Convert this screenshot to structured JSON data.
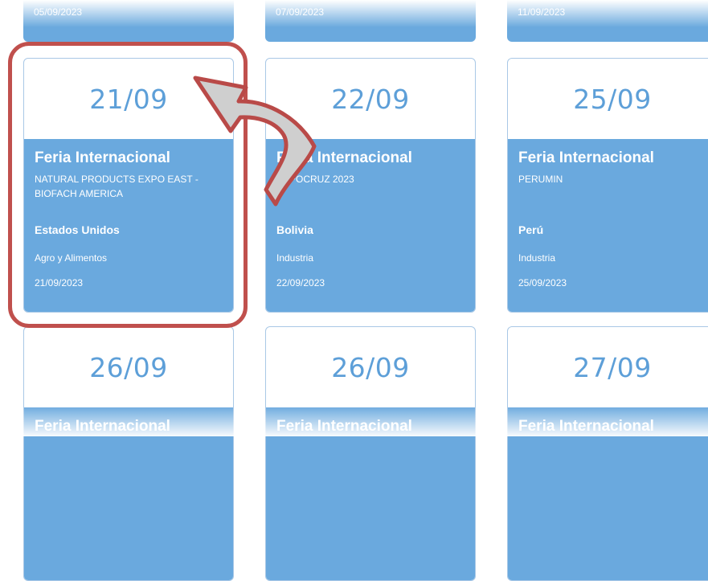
{
  "top_row": [
    {
      "date": "05/09/2023"
    },
    {
      "date": "07/09/2023"
    },
    {
      "date": "11/09/2023"
    }
  ],
  "events": [
    {
      "short_date": "21/09",
      "type": "Feria Internacional",
      "name": "NATURAL PRODUCTS EXPO EAST - BIOFACH AMERICA",
      "country": "Estados Unidos",
      "sector": "Agro y Alimentos",
      "date": "21/09/2023"
    },
    {
      "short_date": "22/09",
      "type": "Feria Internacional",
      "name": "EXPOCRUZ 2023",
      "country": "Bolivia",
      "sector": "Industria",
      "date": "22/09/2023"
    },
    {
      "short_date": "25/09",
      "type": "Feria Internacional",
      "name": "PERUMIN",
      "country": "Perú",
      "sector": "Industria",
      "date": "25/09/2023"
    },
    {
      "short_date": "26/09",
      "type": "Feria Internacional"
    },
    {
      "short_date": "26/09",
      "type": "Feria Internacional"
    },
    {
      "short_date": "27/09",
      "type": "Feria Internacional"
    }
  ],
  "colors": {
    "card_blue": "#6aa9de",
    "date_text": "#5d9fd8",
    "highlight": "#c0504d",
    "arrow_fill": "#cfcfcf"
  }
}
